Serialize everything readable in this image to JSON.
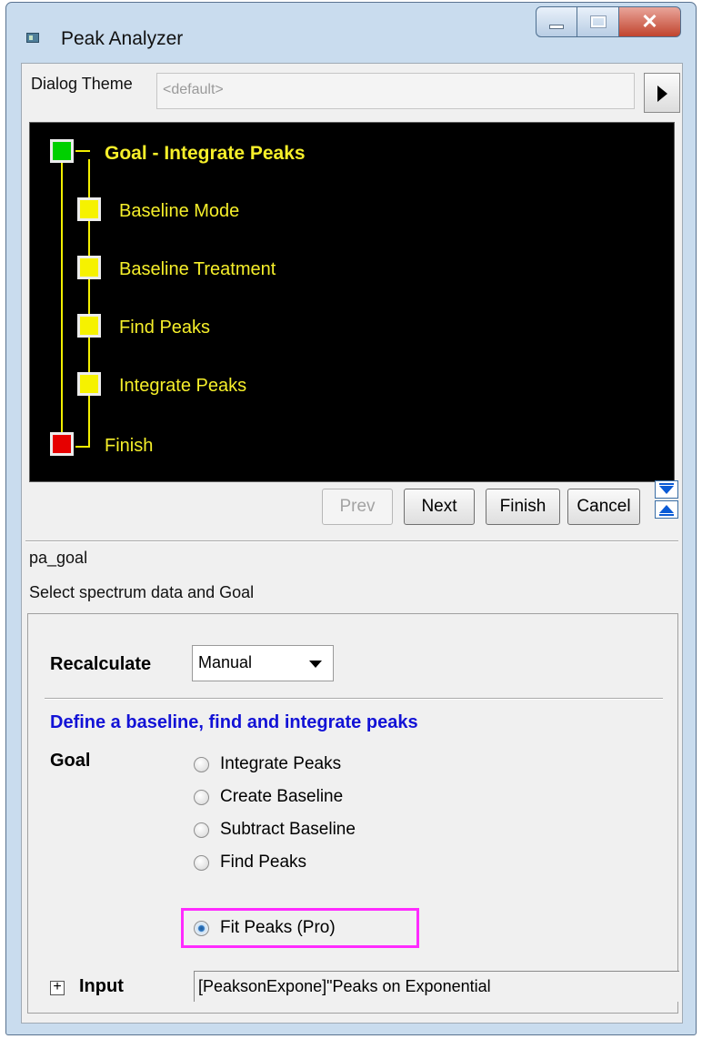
{
  "window": {
    "title": "Peak Analyzer"
  },
  "theme": {
    "label": "Dialog Theme",
    "value": "<default>"
  },
  "tree": {
    "goal": "Goal - Integrate Peaks",
    "steps": [
      "Baseline Mode",
      "Baseline Treatment",
      "Find Peaks",
      "Integrate Peaks"
    ],
    "finish": "Finish"
  },
  "nav": {
    "prev": "Prev",
    "next": "Next",
    "finish": "Finish",
    "cancel": "Cancel"
  },
  "page": {
    "name": "pa_goal",
    "description": "Select spectrum data and Goal"
  },
  "settings": {
    "recalculate_label": "Recalculate",
    "recalculate_value": "Manual",
    "section_title": "Define a baseline, find and integrate peaks",
    "goal_label": "Goal",
    "goal_options": [
      "Integrate Peaks",
      "Create Baseline",
      "Subtract Baseline",
      "Find Peaks",
      "Fit Peaks (Pro)"
    ],
    "goal_selected": "Fit Peaks (Pro)",
    "input_label": "Input",
    "input_value": "[PeaksonExpone]\"Peaks on Exponential"
  },
  "colors": {
    "highlight": "#ff2bff",
    "section_title": "#1212d6",
    "tree_text": "#f6ef2a"
  }
}
